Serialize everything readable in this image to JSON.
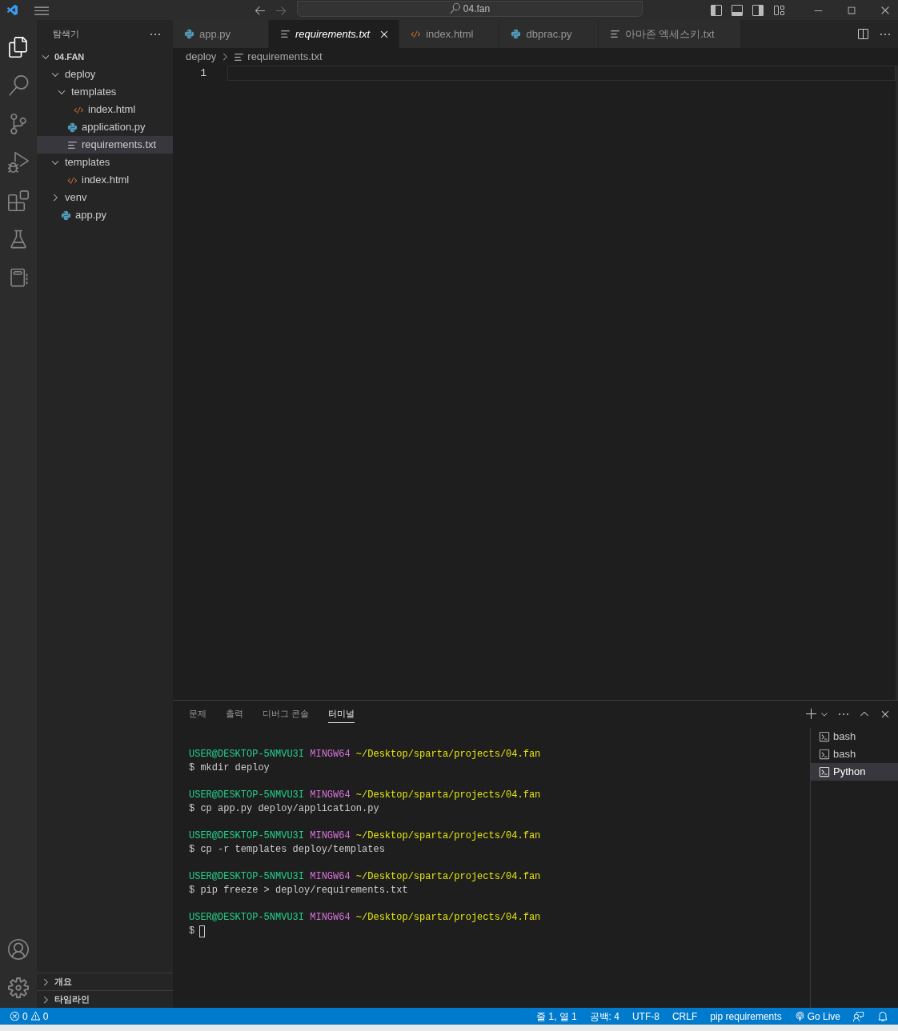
{
  "title_bar": {
    "search": "04.fan"
  },
  "activity_bar": [
    {
      "kind": "explorer",
      "selected": true
    },
    {
      "kind": "search",
      "selected": false
    },
    {
      "kind": "source-control",
      "selected": false
    },
    {
      "kind": "run-debug",
      "selected": false
    },
    {
      "kind": "extensions",
      "selected": false
    },
    {
      "kind": "testing",
      "selected": false
    },
    {
      "kind": "notebook",
      "selected": false
    }
  ],
  "explorer": {
    "title": "탐색기",
    "root": {
      "label": "04.FAN",
      "expanded": true
    },
    "tree": [
      {
        "label": "deploy",
        "kind": "folder",
        "expanded": true,
        "selected": false,
        "children": [
          {
            "label": "templates",
            "kind": "folder",
            "expanded": true,
            "selected": false,
            "children": [
              {
                "label": "index.html",
                "kind": "html",
                "selected": false
              }
            ]
          },
          {
            "label": "application.py",
            "kind": "py",
            "selected": false
          },
          {
            "label": "requirements.txt",
            "kind": "txt",
            "selected": true
          }
        ]
      },
      {
        "label": "templates",
        "kind": "folder",
        "expanded": true,
        "selected": false,
        "children": [
          {
            "label": "index.html",
            "kind": "html",
            "selected": false
          }
        ]
      },
      {
        "label": "venv",
        "kind": "folder",
        "expanded": false,
        "selected": false
      },
      {
        "label": "app.py",
        "kind": "py",
        "selected": false
      }
    ],
    "sections": [
      {
        "label": "개요",
        "expanded": false
      },
      {
        "label": "타임라인",
        "expanded": false
      }
    ]
  },
  "tabs": [
    {
      "label": "app.py",
      "kind": "py",
      "selected": false
    },
    {
      "label": "requirements.txt",
      "kind": "txt",
      "selected": true
    },
    {
      "label": "index.html",
      "kind": "html",
      "selected": false
    },
    {
      "label": "dbprac.py",
      "kind": "py",
      "selected": false
    },
    {
      "label": "아마존 엑세스키.txt",
      "kind": "txt",
      "selected": false
    }
  ],
  "breadcrumb": [
    {
      "label": "deploy",
      "kind": "folder"
    },
    {
      "label": "requirements.txt",
      "kind": "txt"
    }
  ],
  "editor": {
    "line_numbers": [
      "1"
    ]
  },
  "panel": {
    "tabs": [
      {
        "label": "문제",
        "selected": false
      },
      {
        "label": "출력",
        "selected": false
      },
      {
        "label": "디버그 콘솔",
        "selected": false
      },
      {
        "label": "터미널",
        "selected": true
      }
    ],
    "terminal": [
      {
        "user": "USER@DESKTOP-5NMVU3I",
        "host": "MINGW64",
        "path": "~/Desktop/sparta/projects/04.fan",
        "command": "$ mkdir deploy"
      },
      {
        "user": "USER@DESKTOP-5NMVU3I",
        "host": "MINGW64",
        "path": "~/Desktop/sparta/projects/04.fan",
        "command": "$ cp app.py deploy/application.py"
      },
      {
        "user": "USER@DESKTOP-5NMVU3I",
        "host": "MINGW64",
        "path": "~/Desktop/sparta/projects/04.fan",
        "command": "$ cp -r templates deploy/templates"
      },
      {
        "user": "USER@DESKTOP-5NMVU3I",
        "host": "MINGW64",
        "path": "~/Desktop/sparta/projects/04.fan",
        "command": "$ pip freeze > deploy/requirements.txt"
      },
      {
        "user": "USER@DESKTOP-5NMVU3I",
        "host": "MINGW64",
        "path": "~/Desktop/sparta/projects/04.fan",
        "command": "$",
        "cursor": true
      }
    ],
    "terminals": [
      {
        "label": "bash",
        "selected": false
      },
      {
        "label": "bash",
        "selected": false
      },
      {
        "label": "Python",
        "selected": true
      }
    ]
  },
  "status_bar": {
    "errors": "0",
    "warnings": "0",
    "items": [
      {
        "label": "줄 1, 열 1",
        "kind": "text"
      },
      {
        "label": "공백: 4",
        "kind": "text"
      },
      {
        "label": "UTF-8",
        "kind": "text"
      },
      {
        "label": "CRLF",
        "kind": "text"
      },
      {
        "label": "pip requirements",
        "kind": "text"
      },
      {
        "label": "Go Live",
        "kind": "live"
      },
      {
        "kind": "feedback"
      },
      {
        "kind": "bell"
      }
    ]
  }
}
